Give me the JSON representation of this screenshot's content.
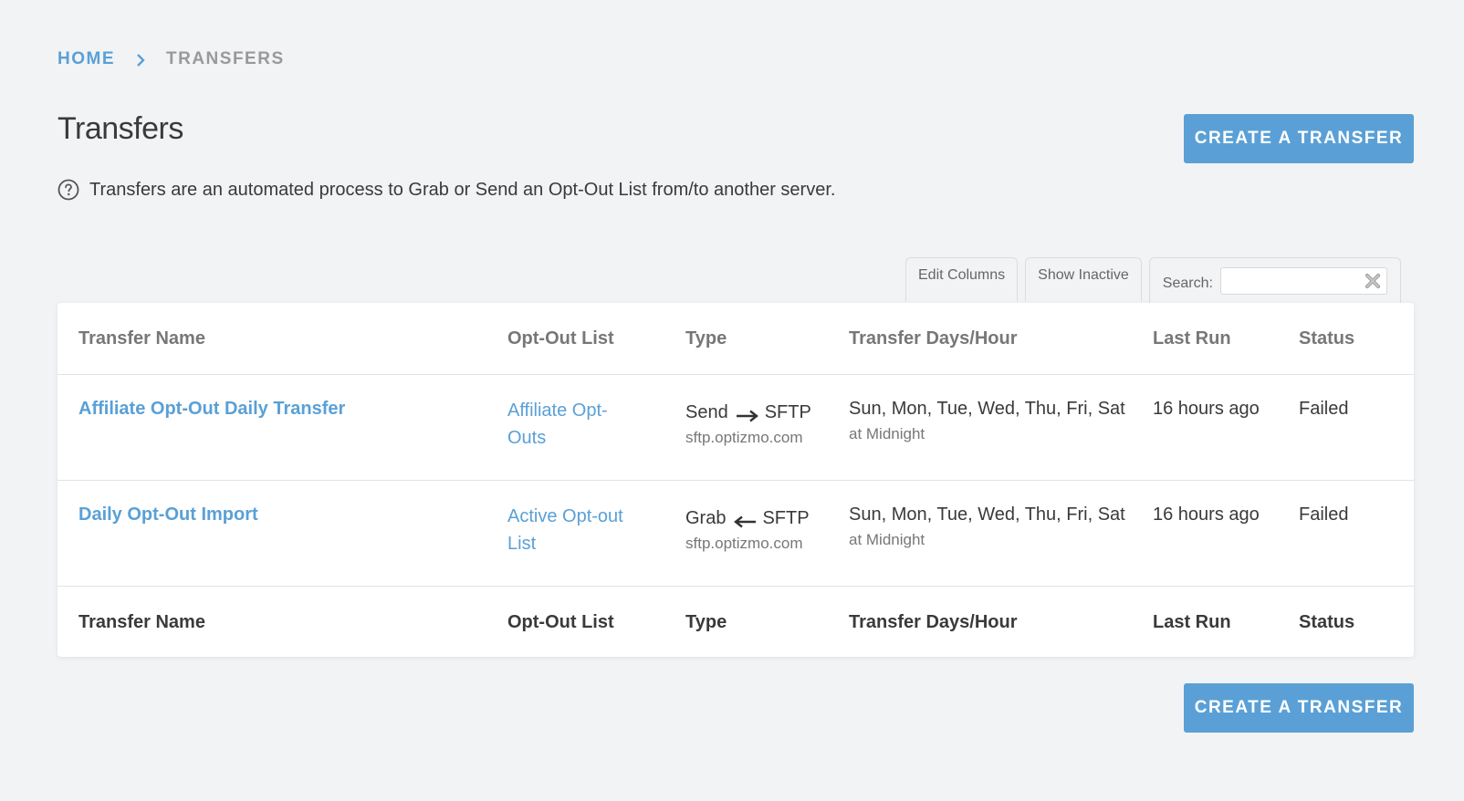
{
  "breadcrumb": {
    "home": "HOME",
    "current": "TRANSFERS"
  },
  "page": {
    "title": "Transfers",
    "create_label": "CREATE A TRANSFER",
    "description": "Transfers are an automated process to Grab or Send an Opt-Out List from/to another server."
  },
  "toolbar": {
    "edit_columns": "Edit Columns",
    "show_inactive": "Show Inactive",
    "search_label": "Search:",
    "search_value": ""
  },
  "table": {
    "columns": [
      "Transfer Name",
      "Opt-Out List",
      "Type",
      "Transfer Days/Hour",
      "Last Run",
      "Status"
    ],
    "rows": [
      {
        "name": "Affiliate Opt-Out Daily Transfer",
        "list": "Affiliate Opt-Outs",
        "type_action": "Send",
        "type_direction": "right-arrow-icon",
        "type_protocol": "SFTP",
        "type_host": "sftp.optizmo.com",
        "days": "Sun, Mon, Tue, Wed, Thu, Fri, Sat",
        "hour": "at Midnight",
        "last_run": "16 hours ago",
        "status": "Failed"
      },
      {
        "name": "Daily Opt-Out Import",
        "list": "Active Opt-out List",
        "type_action": "Grab",
        "type_direction": "left-arrow-icon",
        "type_protocol": "SFTP",
        "type_host": "sftp.optizmo.com",
        "days": "Sun, Mon, Tue, Wed, Thu, Fri, Sat",
        "hour": "at Midnight",
        "last_run": "16 hours ago",
        "status": "Failed"
      }
    ]
  },
  "colors": {
    "accent": "#5aa0d6",
    "background": "#f2f3f5"
  }
}
